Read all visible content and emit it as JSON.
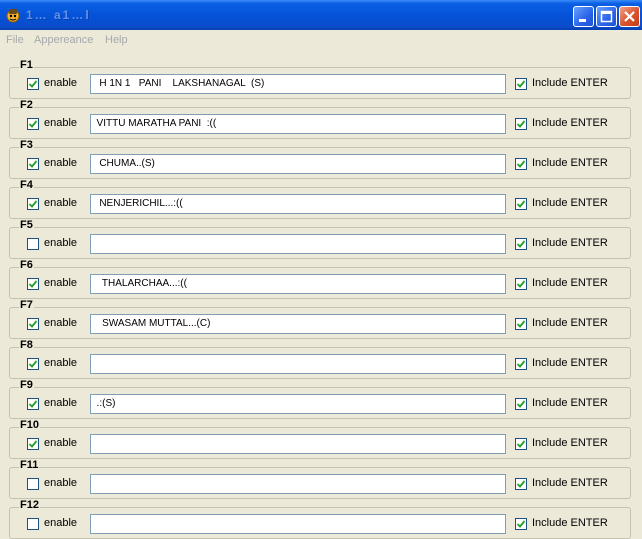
{
  "window": {
    "title": "1…    a1…l",
    "icons": [
      "app-icon",
      "minimize-icon",
      "maximize-icon",
      "close-icon"
    ]
  },
  "menu": [
    {
      "key": "file",
      "label": "File"
    },
    {
      "key": "appearance",
      "label": "Appereance"
    },
    {
      "key": "help",
      "label": "Help"
    }
  ],
  "rows": [
    {
      "key": "F1",
      "enable_label": "enable",
      "enabled": true,
      "text": "   H 1N 1   PANI    LAKSHANAGAL  (S)",
      "include_label": "Include ENTER",
      "include_enter": true
    },
    {
      "key": "F2",
      "enable_label": "enable",
      "enabled": true,
      "text": "  VITTU MARATHA PANI  :((",
      "include_label": "Include ENTER",
      "include_enter": true
    },
    {
      "key": "F3",
      "enable_label": "enable",
      "enabled": true,
      "text": "   CHUMA..(S)",
      "include_label": "Include ENTER",
      "include_enter": true
    },
    {
      "key": "F4",
      "enable_label": "enable",
      "enabled": true,
      "text": "   NENJERICHIL...:((",
      "include_label": "Include ENTER",
      "include_enter": true
    },
    {
      "key": "F5",
      "enable_label": "enable",
      "enabled": false,
      "text": "",
      "include_label": "Include ENTER",
      "include_enter": true
    },
    {
      "key": "F6",
      "enable_label": "enable",
      "enabled": true,
      "text": "    THALARCHAA...:((",
      "include_label": "Include ENTER",
      "include_enter": true
    },
    {
      "key": "F7",
      "enable_label": "enable",
      "enabled": true,
      "text": "    SWASAM MUTTAL...(C)",
      "include_label": "Include ENTER",
      "include_enter": true
    },
    {
      "key": "F8",
      "enable_label": "enable",
      "enabled": true,
      "text": "",
      "include_label": "Include ENTER",
      "include_enter": true
    },
    {
      "key": "F9",
      "enable_label": "enable",
      "enabled": true,
      "text": "  .:(S)",
      "include_label": "Include ENTER",
      "include_enter": true
    },
    {
      "key": "F10",
      "enable_label": "enable",
      "enabled": true,
      "text": "",
      "include_label": "Include ENTER",
      "include_enter": true
    },
    {
      "key": "F11",
      "enable_label": "enable",
      "enabled": false,
      "text": "",
      "include_label": "Include ENTER",
      "include_enter": true
    },
    {
      "key": "F12",
      "enable_label": "enable",
      "enabled": false,
      "text": "",
      "include_label": "Include ENTER",
      "include_enter": true
    }
  ]
}
